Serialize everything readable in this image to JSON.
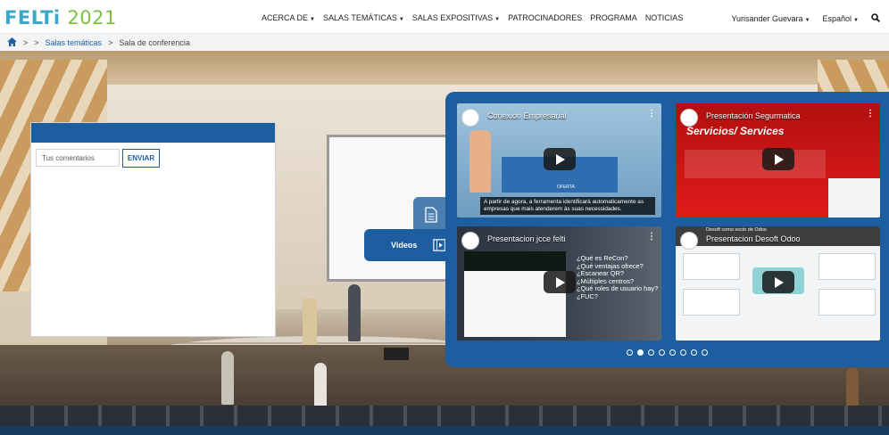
{
  "header": {
    "logo_name": "FELTi",
    "logo_year": "2021",
    "nav": [
      {
        "label": "ACERCA DE",
        "dropdown": true
      },
      {
        "label": "SALAS TEMÁTICAS",
        "dropdown": true
      },
      {
        "label": "SALAS EXPOSITIVAS",
        "dropdown": true
      },
      {
        "label": "PATROCINADORES",
        "dropdown": false
      },
      {
        "label": "PROGRAMA",
        "dropdown": false
      },
      {
        "label": "NOTICIAS",
        "dropdown": false
      }
    ],
    "user": "Yurisander Guevara",
    "language": "Español"
  },
  "breadcrumb": {
    "first": "Salas temáticas",
    "current": "Sala de conferencia",
    "sep": ">"
  },
  "chat": {
    "placeholder": "Tus comentarios",
    "send": "ENVIAR"
  },
  "tabs": {
    "videos": "Videos"
  },
  "videos": [
    {
      "title": "Conexión Empresarial",
      "caption": "A partir de agora, a ferramenta identificará automaticamente as empresas que mais atenderem às suas necessidades.",
      "sub": "OFERTA",
      "bg": "#8fb7d4"
    },
    {
      "title": "Presentación Segurmatica",
      "heading": "Servicios/ Services",
      "bg": "#c71414"
    },
    {
      "title": "Presentacion jcce felti",
      "questions": [
        "¿Qué es ReCon?",
        "¿Qué ventajas ofrece?",
        "¿Escanear QR?",
        "¿Múltiples centros?",
        "¿Qué roles de usuario hay?",
        "¿FUC?"
      ],
      "bg": "#2d3640"
    },
    {
      "title": "Presentacion Desoft Odoo",
      "top": "Desoft como socio de Odoo",
      "bg": "#f2f4f5"
    }
  ],
  "carousel": {
    "count": 8,
    "active": 1
  }
}
